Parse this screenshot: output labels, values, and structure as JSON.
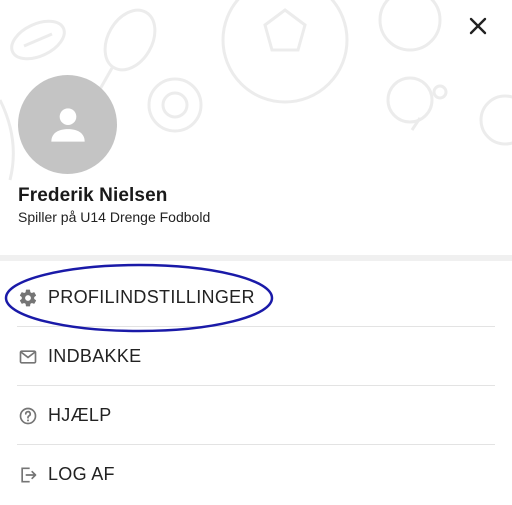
{
  "header": {
    "close_icon": "close-icon"
  },
  "profile": {
    "name": "Frederik Nielsen",
    "role": "Spiller på U14 Drenge Fodbold",
    "avatar_icon": "person-icon"
  },
  "menu": {
    "items": [
      {
        "label": "PROFILINDSTILLINGER",
        "icon": "gear-icon"
      },
      {
        "label": "INDBAKKE",
        "icon": "mail-icon"
      },
      {
        "label": "HJÆLP",
        "icon": "help-icon"
      },
      {
        "label": "LOG AF",
        "icon": "logout-icon"
      }
    ]
  },
  "colors": {
    "avatar_bg": "#c4c4c4",
    "highlight": "#1a1aa8",
    "icon": "#757575",
    "pattern": "#ececec"
  }
}
